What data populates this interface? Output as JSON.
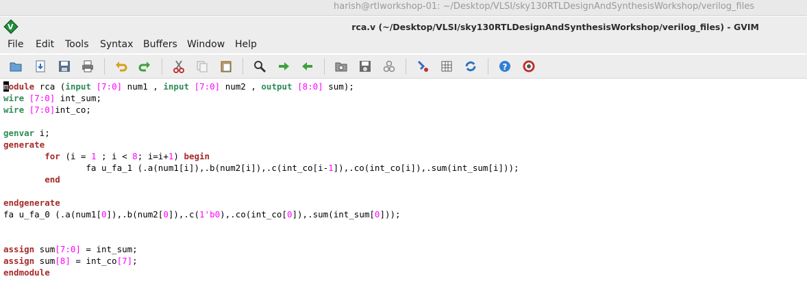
{
  "top_title": "harish@rtlworkshop-01: ~/Desktop/VLSI/sky130RTLDesignAndSynthesisWorkshop/verilog_files",
  "window_title": "rca.v (~/Desktop/VLSI/sky130RTLDesignAndSynthesisWorkshop/verilog_files) - GVIM",
  "menu": [
    "File",
    "Edit",
    "Tools",
    "Syntax",
    "Buffers",
    "Window",
    "Help"
  ],
  "toolbar": [
    "open-icon",
    "save-download-icon",
    "save-icon",
    "print-icon",
    "undo-icon",
    "redo-icon",
    "cut-icon",
    "copy-icon",
    "paste-icon",
    "find-icon",
    "find-next-icon",
    "find-prev-icon",
    "load-session-icon",
    "save-session-icon",
    "run-script-icon",
    "make-icon",
    "shell-icon",
    "ctags-icon",
    "help-icon",
    "find-help-icon"
  ],
  "colors": {
    "keyword": "#a52a2a",
    "type": "#2e8b57",
    "number": "#ff00ff",
    "text": "#000000"
  },
  "code": [
    [
      [
        "m",
        "cursor"
      ],
      [
        "odule",
        "kw"
      ],
      [
        " rca ("
      ],
      [
        "input",
        "ty"
      ],
      [
        " "
      ],
      [
        "[",
        "nm"
      ],
      [
        "7",
        "nm"
      ],
      [
        ":",
        "nm"
      ],
      [
        "0",
        "nm"
      ],
      [
        "]",
        "nm"
      ],
      [
        " num1 , "
      ],
      [
        "input",
        "ty"
      ],
      [
        " "
      ],
      [
        "[7:0]",
        "nm"
      ],
      [
        " num2 , "
      ],
      [
        "output",
        "ty"
      ],
      [
        " "
      ],
      [
        "[8:0]",
        "nm"
      ],
      [
        " sum);"
      ]
    ],
    [
      [
        "wire",
        "ty"
      ],
      [
        " "
      ],
      [
        "[7:0]",
        "nm"
      ],
      [
        " int_sum;"
      ]
    ],
    [
      [
        "wire",
        "ty"
      ],
      [
        " "
      ],
      [
        "[7:0]",
        "nm"
      ],
      [
        "int_co;"
      ]
    ],
    [],
    [
      [
        "genvar",
        "ty"
      ],
      [
        " i;"
      ]
    ],
    [
      [
        "generate",
        "kw"
      ]
    ],
    [
      [
        "        "
      ],
      [
        "for",
        "kw"
      ],
      [
        " (i = "
      ],
      [
        "1",
        "nm"
      ],
      [
        " ; i < "
      ],
      [
        "8",
        "nm"
      ],
      [
        "; i=i+"
      ],
      [
        "1",
        "nm"
      ],
      [
        ") "
      ],
      [
        "begin",
        "kw"
      ]
    ],
    [
      [
        "                fa u_fa_1 (.a(num1[i]),.b(num2[i]),.c(int_co[i-"
      ],
      [
        "1",
        "nm"
      ],
      [
        "]),.co(int_co[i]),.sum(int_sum[i]));"
      ]
    ],
    [
      [
        "        "
      ],
      [
        "end",
        "kw"
      ]
    ],
    [],
    [
      [
        "endgenerate",
        "kw"
      ]
    ],
    [
      [
        "fa u_fa_0 (.a(num1["
      ],
      [
        "0",
        "nm"
      ],
      [
        "]),.b(num2["
      ],
      [
        "0",
        "nm"
      ],
      [
        "]),.c("
      ],
      [
        "1'b0",
        "nm"
      ],
      [
        "),.co(int_co["
      ],
      [
        "0",
        "nm"
      ],
      [
        "]),.sum(int_sum["
      ],
      [
        "0",
        "nm"
      ],
      [
        "]));"
      ]
    ],
    [],
    [],
    [
      [
        "assign",
        "kw"
      ],
      [
        " sum"
      ],
      [
        "[7:0]",
        "nm"
      ],
      [
        " = int_sum;"
      ]
    ],
    [
      [
        "assign",
        "kw"
      ],
      [
        " sum"
      ],
      [
        "[8]",
        "nm"
      ],
      [
        " = int_co"
      ],
      [
        "[7]",
        "nm"
      ],
      [
        ";"
      ]
    ],
    [
      [
        "endmodule",
        "kw"
      ]
    ]
  ]
}
